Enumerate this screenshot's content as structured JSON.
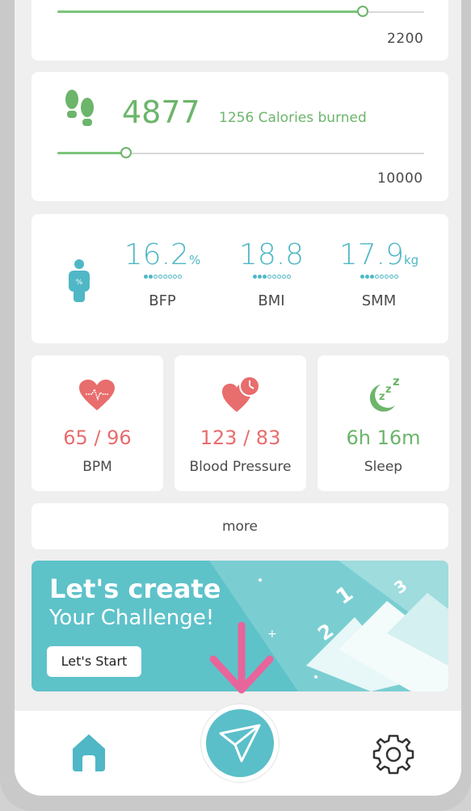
{
  "water": {
    "max": "2200",
    "progress": 0.87
  },
  "steps": {
    "count": "4877",
    "calories": "1256 Calories burned",
    "max": "10000",
    "progress": 0.19
  },
  "body": {
    "metrics": [
      {
        "value": "16.2",
        "unit": "%",
        "label": "BFP"
      },
      {
        "value": "18.8",
        "unit": "",
        "label": "BMI"
      },
      {
        "value": "17.9",
        "unit": "kg",
        "label": "SMM"
      }
    ]
  },
  "tiles": [
    {
      "value": "65 / 96",
      "label": "BPM",
      "icon": "heart-icon",
      "color": "#e86d6d"
    },
    {
      "value": "123 / 83",
      "label": "Blood Pressure",
      "icon": "heart-clock-icon",
      "color": "#e86d6d"
    },
    {
      "value": "6h 16m",
      "label": "Sleep",
      "icon": "moon-zzz-icon",
      "color": "#6cb56b"
    }
  ],
  "more_label": "more",
  "banner": {
    "title": "Let's create",
    "subtitle": "Your Challenge!",
    "button": "Let's Start"
  },
  "nav": {
    "home_icon": "home-icon",
    "center_icon": "send-icon",
    "settings_icon": "gear-icon"
  },
  "colors": {
    "green": "#6cb56b",
    "teal": "#4fb7c5",
    "red": "#e86d6d",
    "accent_pink": "#e8659b"
  }
}
